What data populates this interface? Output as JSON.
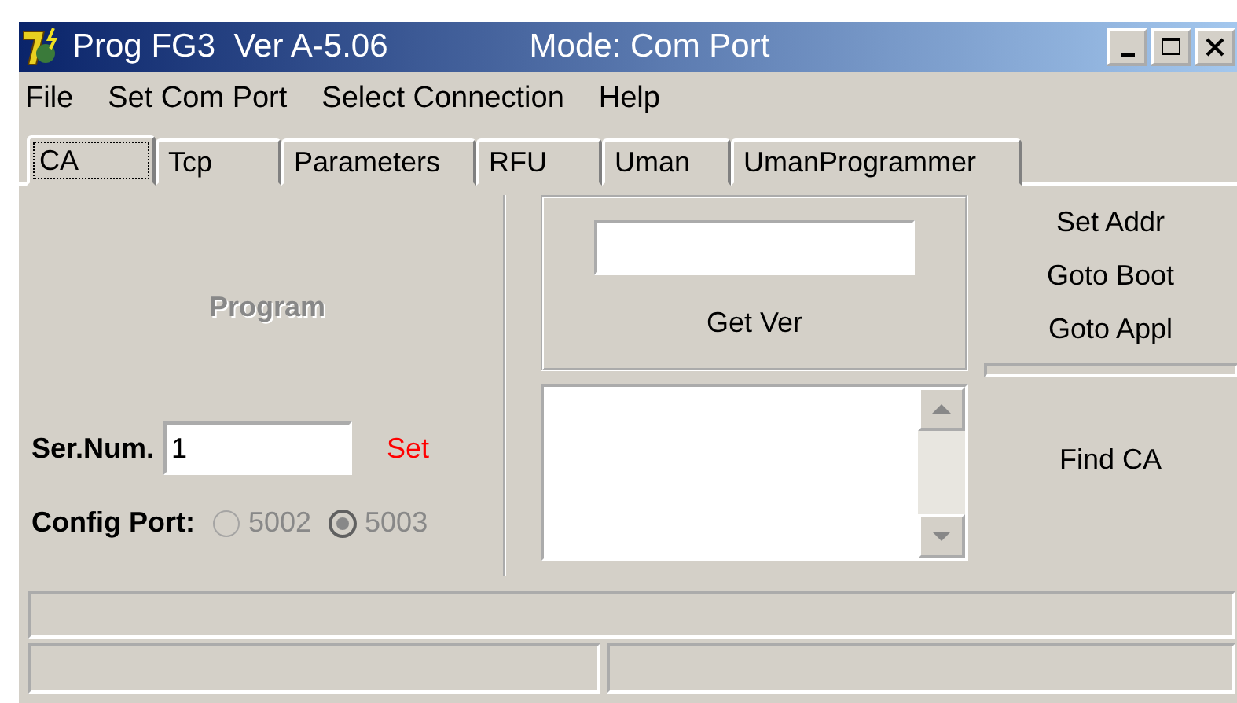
{
  "window": {
    "title": "Prog FG3  Ver A-5.06",
    "mode": "Mode: Com Port"
  },
  "menu": [
    "File",
    "Set Com Port",
    "Select Connection",
    "Help"
  ],
  "tabs": [
    {
      "label": "CA",
      "selected": true
    },
    {
      "label": "Tcp",
      "selected": false
    },
    {
      "label": "Parameters",
      "selected": false
    },
    {
      "label": "RFU",
      "selected": false
    },
    {
      "label": "Uman",
      "selected": false
    },
    {
      "label": "UmanProgrammer",
      "selected": false
    }
  ],
  "program_button": {
    "label": "Program",
    "disabled": true
  },
  "serial": {
    "label": "Ser.Num.",
    "value": "1",
    "set_button": "Set"
  },
  "config_port": {
    "label": "Config Port:",
    "disabled": true,
    "options": [
      {
        "label": "5002",
        "selected": false
      },
      {
        "label": "5003",
        "selected": true
      }
    ]
  },
  "get_ver_button": "Get Ver",
  "right_buttons": [
    "Set Addr",
    "Goto Boot",
    "Goto Appl"
  ],
  "find_button": "Find CA"
}
